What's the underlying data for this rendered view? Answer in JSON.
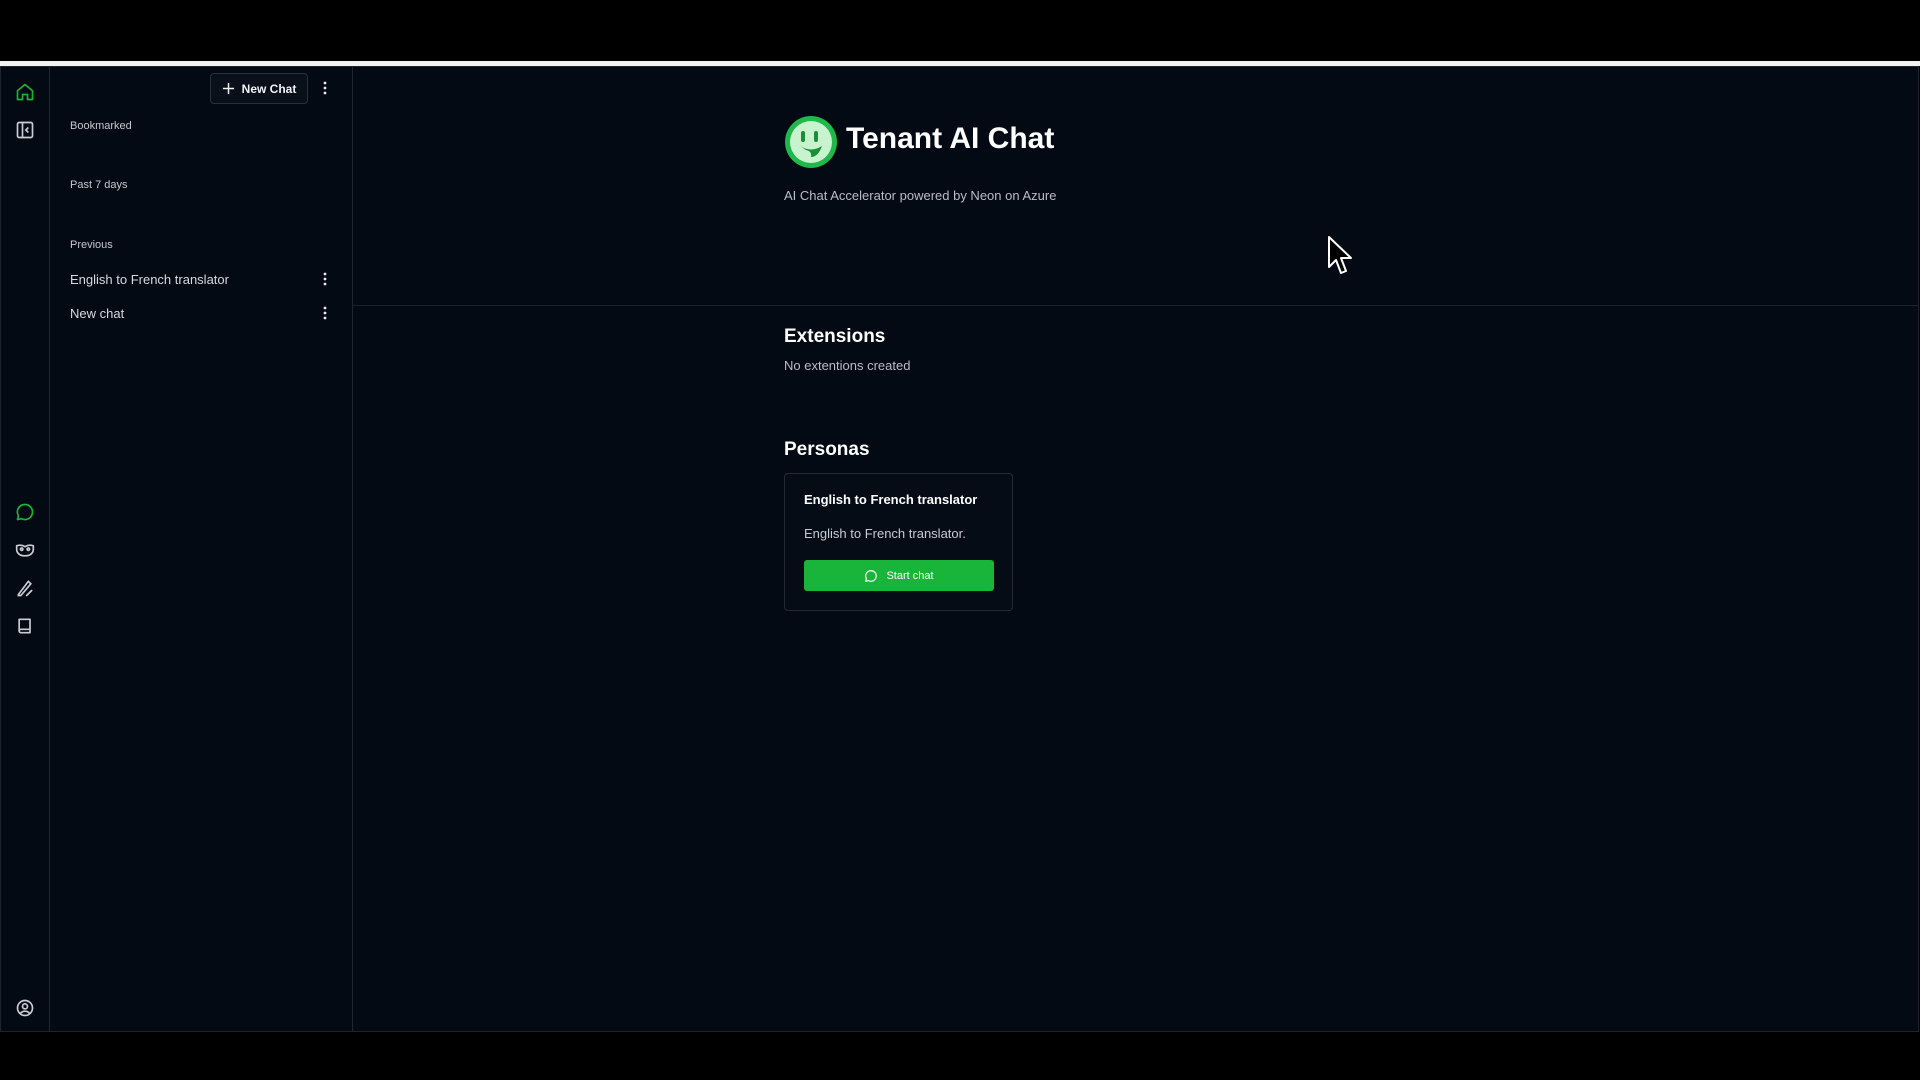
{
  "rail": {
    "top_icons": [
      "home-icon",
      "sidebar-toggle-icon"
    ],
    "nav_icons": [
      "chat-icon",
      "persona-mask-icon",
      "prompts-icon",
      "book-icon"
    ],
    "bottom_icons": [
      "user-profile-icon"
    ],
    "accent_color": "#18b53a"
  },
  "sidebar": {
    "new_chat_label": "New Chat",
    "sections": {
      "bookmarked": "Bookmarked",
      "past_7_days": "Past 7 days",
      "previous": "Previous"
    },
    "chats": [
      {
        "label": "English to French translator"
      },
      {
        "label": "New chat"
      }
    ]
  },
  "main": {
    "title": "Tenant AI Chat",
    "subtitle": "AI Chat Accelerator powered by Neon on Azure",
    "extensions": {
      "heading": "Extensions",
      "empty_text": "No extentions created"
    },
    "personas": {
      "heading": "Personas",
      "cards": [
        {
          "name": "English to French translator",
          "description": "English to French translator.",
          "button_label": "Start chat"
        }
      ]
    }
  }
}
